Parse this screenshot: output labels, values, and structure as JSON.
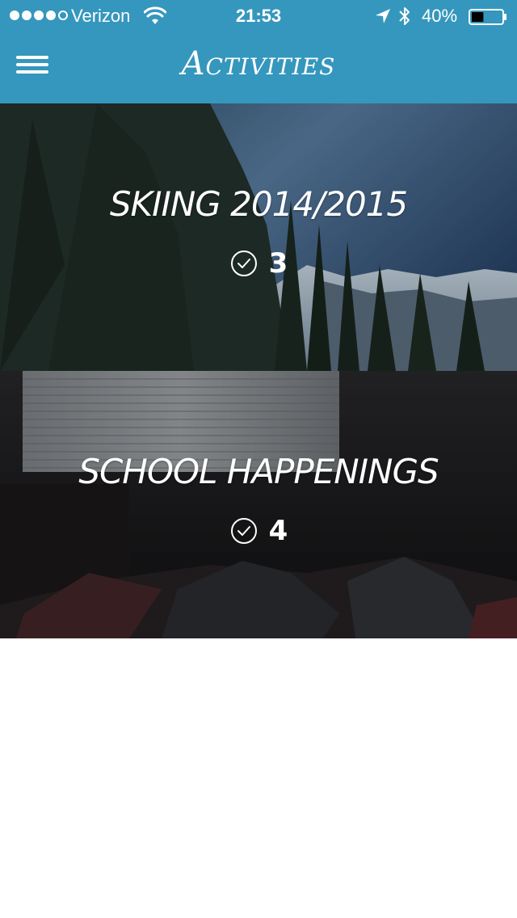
{
  "status_bar": {
    "carrier": "Verizon",
    "time": "21:53",
    "battery": "40%",
    "signal_icon": "signal-dots-icon",
    "wifi_icon": "wifi-icon",
    "location_icon": "location-arrow-icon",
    "bluetooth_icon": "bluetooth-icon",
    "battery_icon": "battery-icon",
    "battery_level": 0.4
  },
  "header": {
    "title": "Activities",
    "menu_icon": "hamburger-menu-icon",
    "color": "#3597bd"
  },
  "activities": [
    {
      "title": "SKIING 2014/2015",
      "count": "3",
      "icon": "check-circle-icon"
    },
    {
      "title": "SCHOOL HAPPENINGS",
      "count": "4",
      "icon": "check-circle-icon"
    }
  ]
}
